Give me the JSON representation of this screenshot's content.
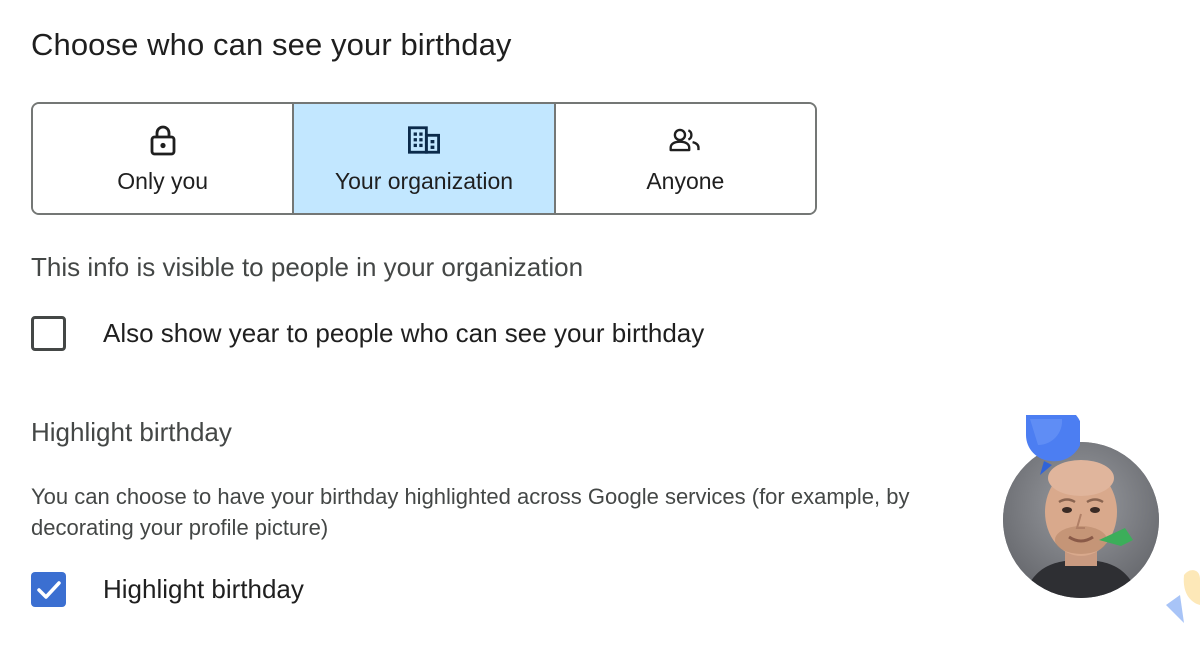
{
  "title": "Choose who can see your birthday",
  "visibility_options": [
    {
      "label": "Only you",
      "icon": "lock-icon",
      "selected": false
    },
    {
      "label": "Your organization",
      "icon": "building-icon",
      "selected": true
    },
    {
      "label": "Anyone",
      "icon": "people-icon",
      "selected": false
    }
  ],
  "visibility_info": "This info is visible to people in your organization",
  "show_year": {
    "label": "Also show year to people who can see your birthday",
    "checked": false
  },
  "highlight_section": {
    "title": "Highlight birthday",
    "description": "You can choose to have your birthday highlighted across Google services (for example, by decorating your profile picture)",
    "checkbox_label": "Highlight birthday",
    "checked": true
  },
  "colors": {
    "selected_segment_bg": "#c2e7ff",
    "checkbox_checked": "#3b6fd1",
    "border": "#747775",
    "secondary_text": "#444746",
    "balloon_blue": "#4c7ef2",
    "decoration_green": "#3cae5a"
  }
}
